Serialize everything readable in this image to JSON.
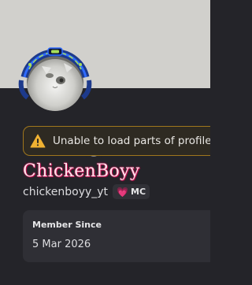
{
  "profile": {
    "banner_color": "#d1d0cc",
    "avatar": {
      "description_icon": "cat-avatar-icon",
      "decoration_color": "#2f6bff",
      "accent_color": "#a7e05a",
      "status": "offline"
    },
    "alert": {
      "icon": "warning-icon",
      "text": "Unable to load parts of profile",
      "color": "#f0b232"
    },
    "display_name": "ChickenBoyy",
    "username": "chickenboyy_yt",
    "tag": {
      "icon": "heart-icon",
      "label": "MC"
    },
    "member_since": {
      "title": "Member Since",
      "value": "5 Mar 2026"
    }
  }
}
